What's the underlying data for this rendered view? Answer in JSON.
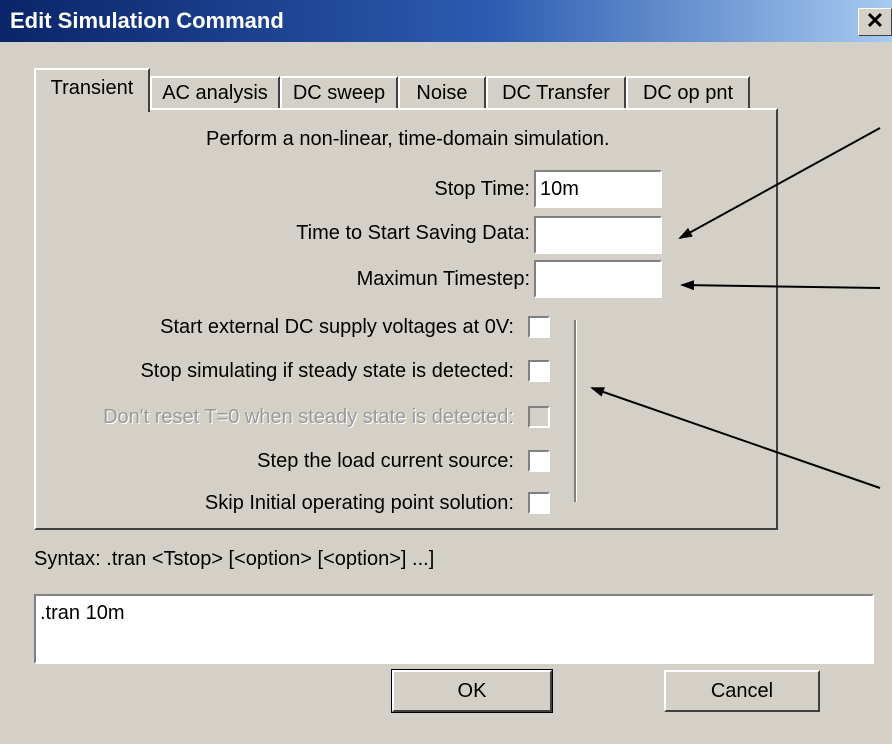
{
  "window": {
    "title": "Edit Simulation Command",
    "close_label": "✕"
  },
  "tabs": [
    {
      "label": "Transient"
    },
    {
      "label": "AC analysis"
    },
    {
      "label": "DC sweep"
    },
    {
      "label": "Noise"
    },
    {
      "label": "DC Transfer"
    },
    {
      "label": "DC op pnt"
    }
  ],
  "transient": {
    "description": "Perform a non-linear, time-domain simulation.",
    "stop_time_label": "Stop Time:",
    "stop_time_value": "10m",
    "start_saving_label": "Time to Start Saving Data:",
    "start_saving_value": "",
    "max_timestep_label": "Maximun Timestep:",
    "max_timestep_value": "",
    "options": [
      {
        "label": "Start external DC supply voltages at 0V:",
        "checked": false,
        "disabled": false
      },
      {
        "label": "Stop simulating if steady state is detected:",
        "checked": false,
        "disabled": false
      },
      {
        "label": "Don't reset T=0 when steady state is detected:",
        "checked": false,
        "disabled": true
      },
      {
        "label": "Step the load current source:",
        "checked": false,
        "disabled": false
      },
      {
        "label": "Skip Initial operating point solution:",
        "checked": false,
        "disabled": false
      }
    ]
  },
  "syntax": "Syntax:  .tran <Tstop> [<option> [<option>] ...]",
  "command_text": ".tran 10m",
  "buttons": {
    "ok": "OK",
    "cancel": "Cancel"
  }
}
